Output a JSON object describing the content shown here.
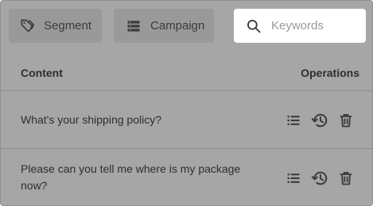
{
  "toolbar": {
    "segment_label": "Segment",
    "segment_icon": "tag-icon",
    "campaign_label": "Campaign",
    "campaign_icon": "list-icon",
    "search": {
      "placeholder": "Keywords",
      "value": "",
      "icon": "search-icon"
    }
  },
  "table": {
    "columns": [
      "Content",
      "Operations"
    ],
    "rows": [
      {
        "content": "What's your shipping policy?",
        "operations": [
          "list-icon",
          "history-icon",
          "trash-icon"
        ]
      },
      {
        "content": "Please can you tell me where is my package now?",
        "operations": [
          "list-icon",
          "history-icon",
          "trash-icon"
        ]
      }
    ]
  },
  "colors": {
    "overlay_bg": "#a6a6a6",
    "button_bg": "#999999",
    "text": "#2e2e2e",
    "icon": "#3a3a3a",
    "search_bg": "#ffffff"
  }
}
